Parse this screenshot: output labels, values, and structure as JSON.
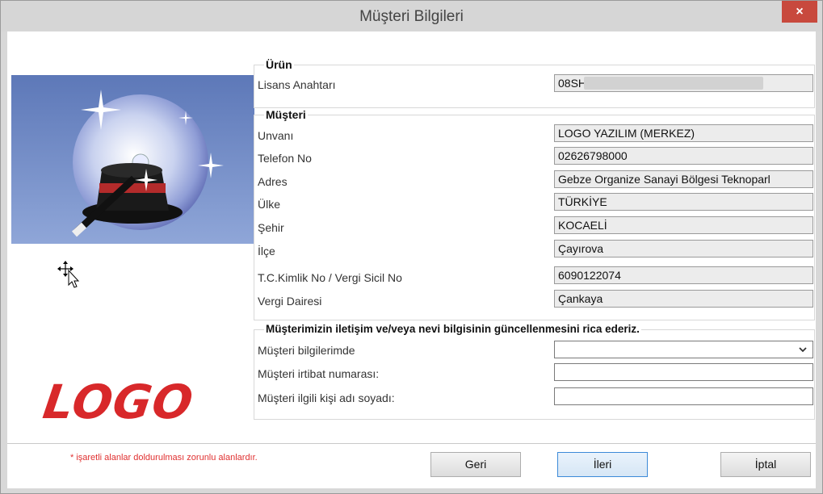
{
  "window": {
    "title": "Müşteri Bilgileri",
    "close_symbol": "×"
  },
  "logo_text": "LOGO",
  "product": {
    "title": "Ürün",
    "license_label": "Lisans Anahtarı",
    "license_value": "08SH;"
  },
  "customer": {
    "title": "Müşteri",
    "fields": [
      {
        "label": "Unvanı",
        "value": "LOGO YAZILIM (MERKEZ)"
      },
      {
        "label": "Telefon No",
        "value": "02626798000"
      },
      {
        "label": "Adres",
        "value": "Gebze Organize Sanayi Bölgesi Teknoparl"
      },
      {
        "label": "Ülke",
        "value": "TÜRKİYE"
      },
      {
        "label": "Şehir",
        "value": "KOCAELİ"
      },
      {
        "label": "İlçe",
        "value": "Çayırova"
      },
      {
        "label": "T.C.Kimlik No / Vergi Sicil No",
        "value": "6090122074"
      },
      {
        "label": "Vergi Dairesi",
        "value": "Çankaya"
      }
    ]
  },
  "update_request": {
    "title": "Müşterimizin iletişim ve/veya nevi bilgisinin güncellenmesini rica ederiz.",
    "fields": [
      {
        "label": "Müşteri bilgilerimde",
        "value": ""
      },
      {
        "label": "Müşteri irtibat numarası:",
        "value": ""
      },
      {
        "label": "Müşteri ilgili kişi adı soyadı:",
        "value": ""
      }
    ]
  },
  "footer": {
    "required_note": "* işaretli alanlar doldurulması zorunlu alanlardır.",
    "back_label": "Geri",
    "next_label": "İleri",
    "cancel_label": "İptal"
  },
  "icons": [
    "close-icon",
    "magic-hat-cd-icon",
    "move-cursor-icon",
    "chevron-down-icon"
  ],
  "colors": {
    "logo_red": "#d8282a",
    "close_red": "#c8493d",
    "note_red": "#e03030"
  }
}
